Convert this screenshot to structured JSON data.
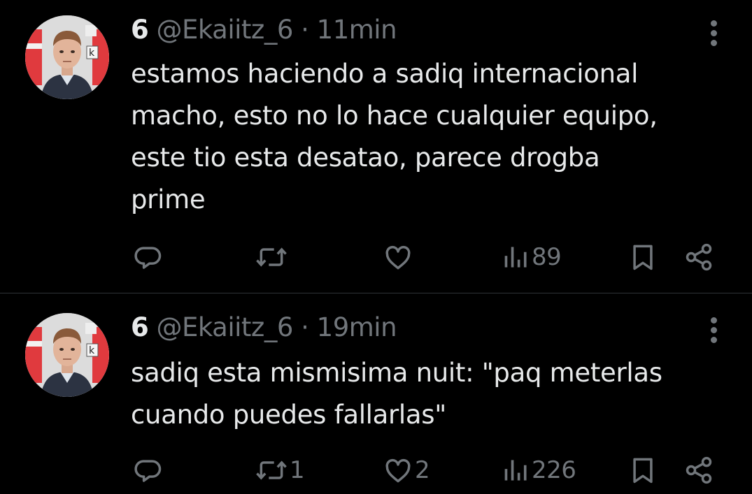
{
  "colors": {
    "background": "#000000",
    "text_primary": "#e7e9ea",
    "text_secondary": "#71767b",
    "divider": "#2f3336"
  },
  "tweets": [
    {
      "display_name": "6",
      "handle": "@Ekaiitz_6",
      "separator": "·",
      "time": "11min",
      "text_lines": [
        "estamos haciendo a sadiq internacional",
        "macho, esto no lo hace cualquier equipo,",
        "este tio esta desatao, parece drogba",
        "prime"
      ],
      "actions": {
        "reply_icon": "reply-icon",
        "retweet_icon": "retweet-icon",
        "retweet_count": "",
        "like_icon": "heart-icon",
        "like_count": "",
        "views_icon": "views-icon",
        "views_count": "89",
        "bookmark_icon": "bookmark-icon",
        "share_icon": "share-icon"
      }
    },
    {
      "display_name": "6",
      "handle": "@Ekaiitz_6",
      "separator": "·",
      "time": "19min",
      "text_lines": [
        "sadiq esta mismisima nuit: \"paq meterlas",
        "cuando puedes fallarlas\""
      ],
      "actions": {
        "reply_icon": "reply-icon",
        "retweet_icon": "retweet-icon",
        "retweet_count": "1",
        "like_icon": "heart-icon",
        "like_count": "2",
        "views_icon": "views-icon",
        "views_count": "226",
        "bookmark_icon": "bookmark-icon",
        "share_icon": "share-icon"
      }
    }
  ]
}
